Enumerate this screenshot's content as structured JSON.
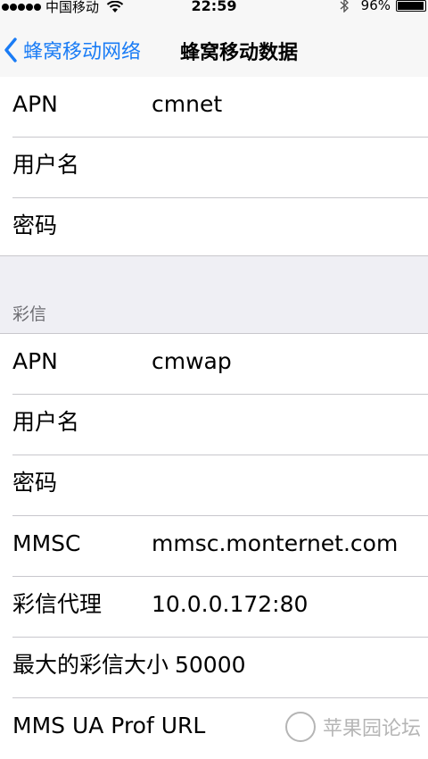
{
  "status_bar": {
    "carrier": "中国移动",
    "time": "22:59",
    "battery": "96%",
    "battery_level": 0.96,
    "icons": [
      "signal-dots-icon",
      "wifi-icon",
      "bluetooth-icon",
      "battery-icon"
    ]
  },
  "nav": {
    "back_label": "蜂窝移动网络",
    "title": "蜂窝移动数据"
  },
  "data_group": {
    "rows": [
      {
        "label": "APN",
        "value": "cmnet"
      },
      {
        "label": "用户名",
        "value": ""
      },
      {
        "label": "密码",
        "value": ""
      }
    ]
  },
  "mms_group": {
    "header": "彩信",
    "rows": [
      {
        "label": "APN",
        "value": "cmwap"
      },
      {
        "label": "用户名",
        "value": ""
      },
      {
        "label": "密码",
        "value": ""
      },
      {
        "label": "MMSC",
        "value": "mmsc.monternet.com"
      },
      {
        "label": "彩信代理",
        "value": "10.0.0.172:80"
      },
      {
        "label": "最大的彩信大小",
        "value": "50000"
      },
      {
        "label": "MMS UA Prof URL",
        "value": ""
      }
    ]
  },
  "colors": {
    "accent": "#1a7cf5",
    "background": "#efeff4",
    "separator": "#c8c7cc",
    "section_header": "#6d6d72"
  },
  "watermark": {
    "text": "苹果园论坛"
  }
}
